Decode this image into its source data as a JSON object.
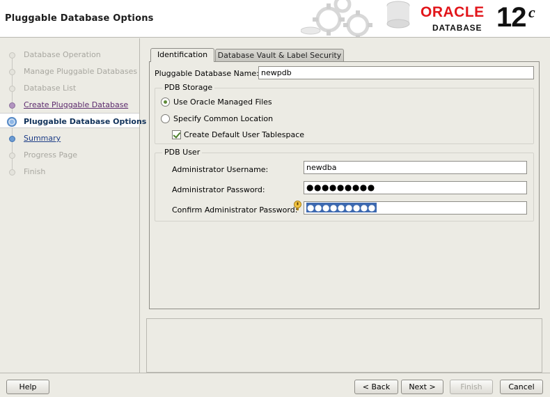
{
  "header": {
    "title": "Pluggable Database Options",
    "logo_brand": "ORACLE",
    "logo_product": "DATABASE",
    "logo_version": "12",
    "logo_version_suffix": "c"
  },
  "nav": {
    "items": [
      {
        "label": "Database Operation",
        "state": "disabled"
      },
      {
        "label": "Manage Pluggable Databases",
        "state": "disabled"
      },
      {
        "label": "Database List",
        "state": "disabled"
      },
      {
        "label": "Create Pluggable Database",
        "state": "visited"
      },
      {
        "label": "Pluggable Database Options",
        "state": "current"
      },
      {
        "label": "Summary",
        "state": "link"
      },
      {
        "label": "Progress Page",
        "state": "disabled"
      },
      {
        "label": "Finish",
        "state": "disabled"
      }
    ]
  },
  "tabs": [
    {
      "label": "Identification",
      "selected": true
    },
    {
      "label": "Database Vault & Label Security",
      "selected": false
    }
  ],
  "form": {
    "pdb_name_label": "Pluggable Database Name:",
    "pdb_name_value": "newpdb",
    "storage": {
      "title": "PDB Storage",
      "option_managed": "Use Oracle Managed Files",
      "option_common": "Specify Common Location",
      "selected": "managed",
      "tablespace_label": "Create Default User Tablespace",
      "tablespace_checked": true
    },
    "user": {
      "title": "PDB User",
      "username_label": "Administrator Username:",
      "username_value": "newdba",
      "password_label": "Administrator Password:",
      "password_value": "●●●●●●●●●",
      "confirm_label": "Confirm Administrator Password:",
      "confirm_value": "●●●●●●●●●"
    }
  },
  "buttons": {
    "help": "Help",
    "back": "< Back",
    "next": "Next >",
    "finish": "Finish",
    "cancel": "Cancel"
  }
}
